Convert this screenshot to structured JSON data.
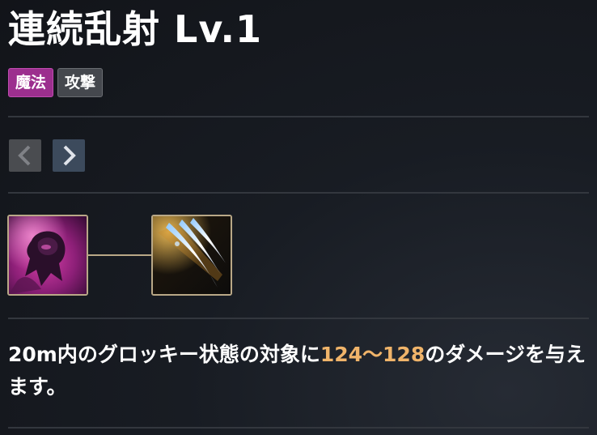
{
  "skill": {
    "title": "連続乱射 Lv.1",
    "tags": [
      {
        "label": "魔法",
        "color": "#9c2f8e"
      },
      {
        "label": "攻撃",
        "color": "#45484e"
      }
    ]
  },
  "navigation": {
    "prev_icon": "chevron-left-icon",
    "next_icon": "chevron-right-icon"
  },
  "skill_tree": {
    "icons": [
      {
        "name": "purple-hooded-figure-icon"
      },
      {
        "name": "silver-claw-slash-icon"
      }
    ],
    "border_color": "#b9a887"
  },
  "description": {
    "before": "20m内のグロッキー状態の対象に",
    "highlight": "124〜128",
    "after": "のダメージを与えます。",
    "highlight_color": "#f0b46a"
  }
}
